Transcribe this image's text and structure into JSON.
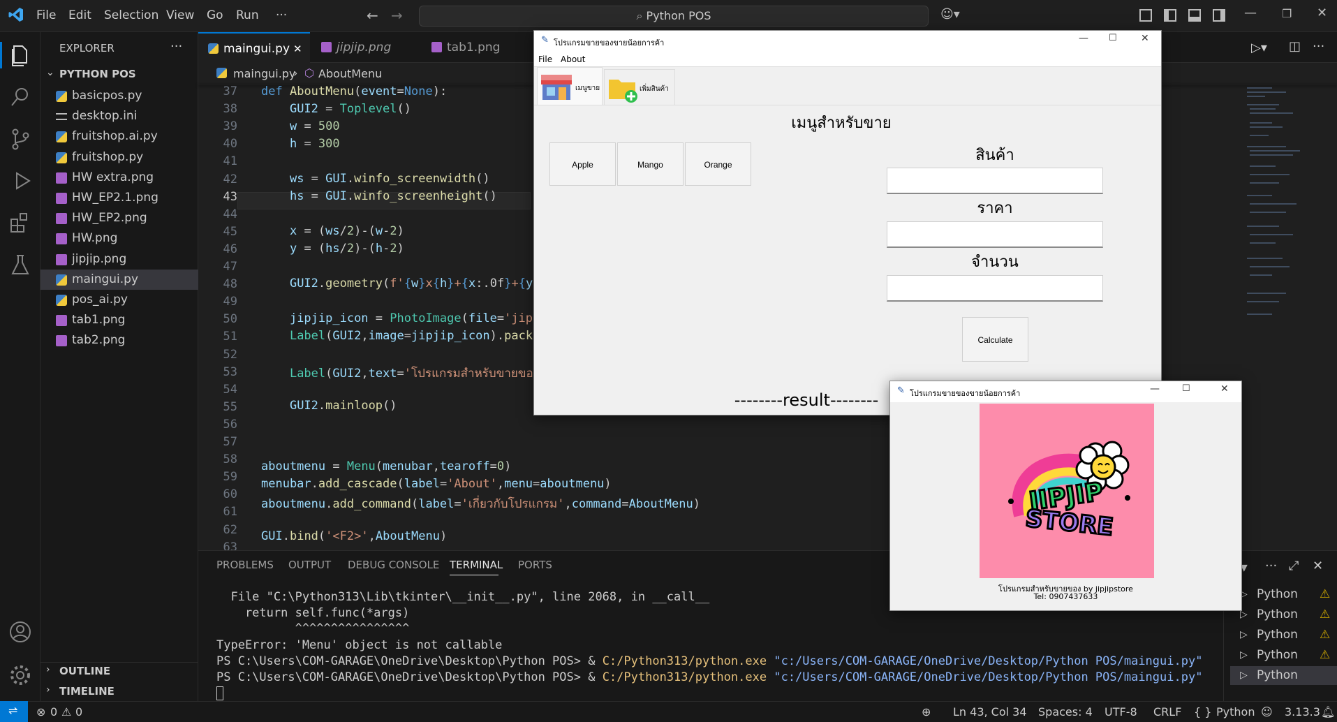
{
  "titlebar": {
    "menus": [
      "File",
      "Edit",
      "Selection",
      "View",
      "Go",
      "Run",
      "···"
    ],
    "search": "Python POS"
  },
  "sidebar": {
    "header": "EXPLORER",
    "folder": "PYTHON POS",
    "files": [
      {
        "name": "basicpos.py",
        "type": "py"
      },
      {
        "name": "desktop.ini",
        "type": "ini"
      },
      {
        "name": "fruitshop.ai.py",
        "type": "py"
      },
      {
        "name": "fruitshop.py",
        "type": "py"
      },
      {
        "name": "HW extra.png",
        "type": "png"
      },
      {
        "name": "HW_EP2.1.png",
        "type": "png"
      },
      {
        "name": "HW_EP2.png",
        "type": "png"
      },
      {
        "name": "HW.png",
        "type": "png"
      },
      {
        "name": "jipjip.png",
        "type": "png"
      },
      {
        "name": "maingui.py",
        "type": "py"
      },
      {
        "name": "pos_ai.py",
        "type": "py"
      },
      {
        "name": "tab1.png",
        "type": "png"
      },
      {
        "name": "tab2.png",
        "type": "png"
      }
    ],
    "outline": "OUTLINE",
    "timeline": "TIMELINE"
  },
  "editor": {
    "tabs": [
      "maingui.py",
      "jipjip.png",
      "tab1.png"
    ],
    "breadcrumb": [
      "maingui.py",
      "AboutMenu"
    ],
    "line_numbers": [
      "37",
      "38",
      "39",
      "40",
      "41",
      "42",
      "43",
      "44",
      "45",
      "46",
      "47",
      "48",
      "49",
      "50",
      "51",
      "52",
      "53",
      "54",
      "55",
      "56",
      "57",
      "58",
      "59",
      "60",
      "61",
      "62",
      "63"
    ]
  },
  "panel": {
    "tabs": [
      "PROBLEMS",
      "OUTPUT",
      "DEBUG CONSOLE",
      "TERMINAL",
      "PORTS"
    ],
    "terminal": [
      "  File \"C:\\Python313\\Lib\\tkinter\\__init__.py\", line 2068, in __call__",
      "    return self.func(*args)",
      "           ^^^^^^^^^^^^^^^^",
      "TypeError: 'Menu' object is not callable",
      "PS C:\\Users\\COM-GARAGE\\OneDrive\\Desktop\\Python POS> & C:/Python313/python.exe \"c:/Users/COM-GARAGE/OneDrive/Desktop/Python POS/maingui.py\"",
      "PS C:\\Users\\COM-GARAGE\\OneDrive\\Desktop\\Python POS> & C:/Python313/python.exe \"c:/Users/COM-GARAGE/OneDrive/Desktop/Python POS/maingui.py\""
    ],
    "terminals": [
      "Python",
      "Python",
      "Python",
      "Python",
      "Python"
    ]
  },
  "statusbar": {
    "problems": "0",
    "warnings": "0",
    "position": "Ln 43, Col 34",
    "spaces": "Spaces: 4",
    "encoding": "UTF-8",
    "eol": "CRLF",
    "language": "Python",
    "version": "3.13.3"
  },
  "tk_main": {
    "title": "โปรแกรมขายของขายน้อยการค้า",
    "menus": [
      "File",
      "About"
    ],
    "tabs": [
      "เมนูขาย",
      "เพิ่มสินค้า"
    ],
    "heading": "เมนูสำหรับขาย",
    "products": [
      "Apple",
      "Mango",
      "Orange"
    ],
    "labels": [
      "สินค้า",
      "ราคา",
      "จำนวน"
    ],
    "calc_button": "Calculate",
    "result": "--------result--------"
  },
  "tk_about": {
    "title": "โปรแกรมขายของขายน้อยการค้า",
    "logo_text_1": "JIPJIP",
    "logo_text_2": "STORE",
    "caption": "โปรแกรมสำหรับขายของ by jipjipstore",
    "tel": "Tel: 0907437633"
  }
}
